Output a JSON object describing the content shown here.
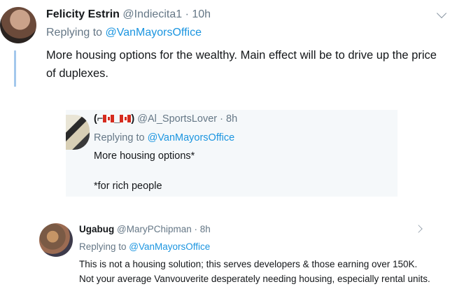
{
  "tweets": [
    {
      "display_name": "Felicity Estrin",
      "handle": "@Indiecita1",
      "time": "10h",
      "replying_prefix": "Replying to ",
      "replying_to": "@VanMayorsOffice",
      "body": "More housing options for the wealthy. Main effect will be to drive up the price of duplexes."
    },
    {
      "display_name_left": "(⌐",
      "display_name_right": ")",
      "handle": "@Al_SportsLover",
      "time": "8h",
      "replying_prefix": "Replying to ",
      "replying_to": "@VanMayorsOffice",
      "body_line1": "More housing options*",
      "body_line2": "*for rich people"
    },
    {
      "display_name": "Ugabug",
      "handle": "@MaryPChipman",
      "time": "8h",
      "replying_prefix": "Replying to ",
      "replying_to": "@VanMayorsOffice",
      "body": "This is not a housing solution; this serves developers & those earning over 150K. Not your average Vanvouverite desperately needing housing, especially rental units."
    }
  ],
  "separators": {
    "dot": "·"
  },
  "colors": {
    "link": "#1b95e0",
    "muted": "#657786",
    "thread_line": "#a3c8ec",
    "quote_bg": "#f5f8fa"
  },
  "icons": {
    "caret": "chevron-down-icon",
    "flag": "canada-flag-icon"
  }
}
